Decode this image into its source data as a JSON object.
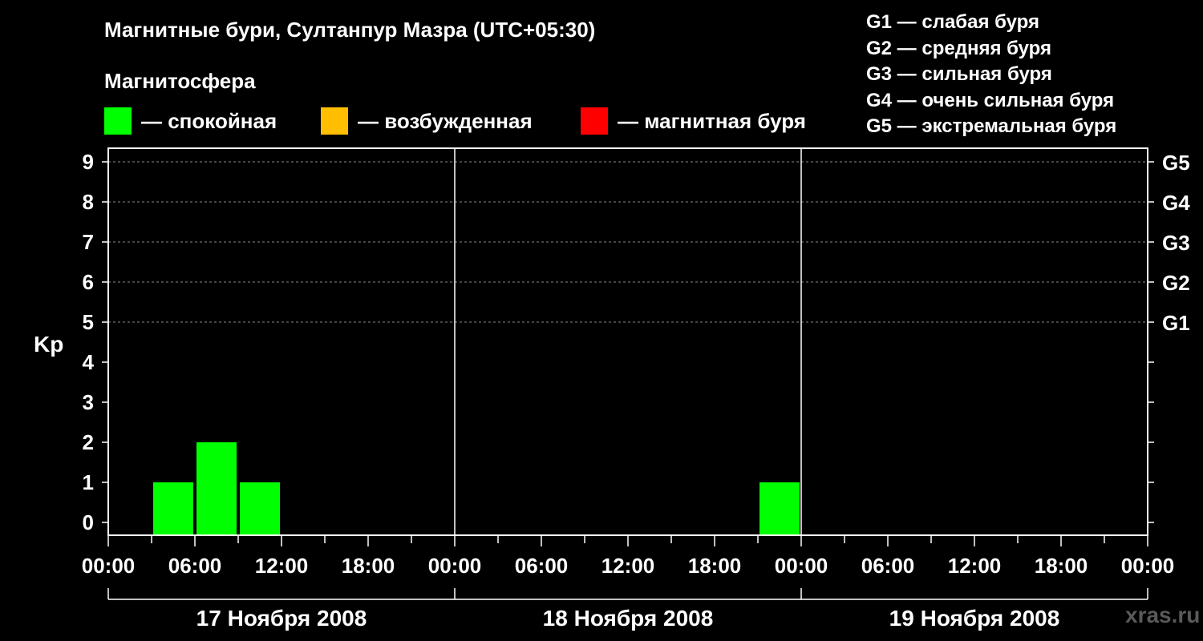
{
  "title": "Магнитные бури, Султанпур Мазра (UTC+05:30)",
  "subtitle": "Магнитосфера",
  "legend": [
    {
      "label": "— спокойная",
      "color": "#00ff00"
    },
    {
      "label": "— возбужденная",
      "color": "#ffbf00"
    },
    {
      "label": "— магнитная буря",
      "color": "#ff0000"
    }
  ],
  "g_legend": [
    "G1 — слабая буря",
    "G2 — средняя буря",
    "G3 — сильная буря",
    "G4 — очень сильная буря",
    "G5 — экстремальная буря"
  ],
  "watermark": "xras.ru",
  "chart_data": {
    "type": "bar",
    "ylabel": "Kp",
    "ylim": [
      0,
      9
    ],
    "y_ticks": [
      "0",
      "1",
      "2",
      "3",
      "4",
      "5",
      "6",
      "7",
      "8",
      "9"
    ],
    "right_ticks": [
      {
        "y": 5,
        "label": "G1"
      },
      {
        "y": 6,
        "label": "G2"
      },
      {
        "y": 7,
        "label": "G3"
      },
      {
        "y": 8,
        "label": "G4"
      },
      {
        "y": 9,
        "label": "G5"
      }
    ],
    "x_tick_labels": [
      "00:00",
      "06:00",
      "12:00",
      "18:00",
      "00:00",
      "06:00",
      "12:00",
      "18:00",
      "00:00",
      "06:00",
      "12:00",
      "18:00",
      "00:00"
    ],
    "days": [
      "17 Ноября 2008",
      "18 Ноября 2008",
      "19 Ноября 2008"
    ],
    "interval_hours": 3,
    "series": [
      {
        "values": [
          0,
          1,
          2,
          1,
          0,
          0,
          0,
          0,
          0,
          0,
          0,
          0,
          0,
          0,
          0,
          1,
          0,
          0,
          0,
          0,
          0,
          0,
          0,
          0
        ],
        "color": "#00ff00"
      }
    ],
    "grid": "dashed horizontal at G-levels",
    "colors": {
      "quiet": "#00ff00",
      "unsettled": "#ffbf00",
      "storm": "#ff0000"
    }
  }
}
